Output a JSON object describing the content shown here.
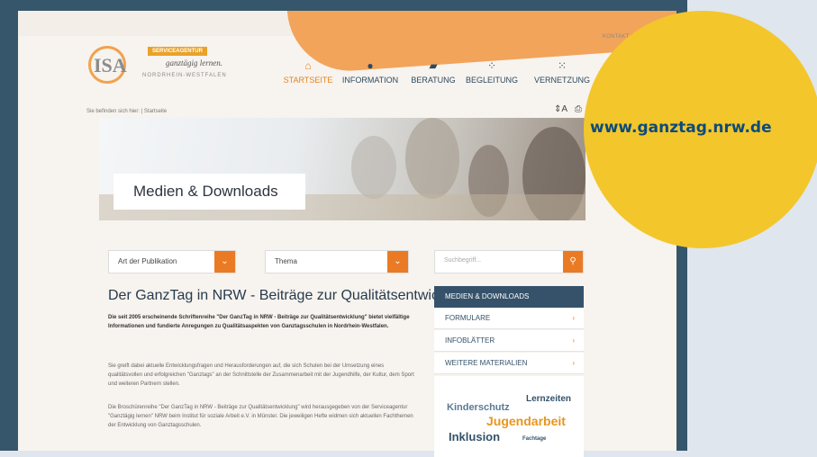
{
  "meta_links": "KONTAKT | IMPRESSUM | DATENSCHUTZ | SITEMAP",
  "logo": {
    "mark": "ISA",
    "badge": "SERVICEAGENTUR",
    "tagline": "ganztägig lernen.",
    "region": "NORDRHEIN-WESTFALEN"
  },
  "nav": [
    {
      "icon": "home-icon",
      "label": "STARTSEITE",
      "active": true
    },
    {
      "icon": "info-icon",
      "label": "INFORMATION",
      "active": false
    },
    {
      "icon": "chat-icon",
      "label": "BERATUNG",
      "active": false
    },
    {
      "icon": "people-icon",
      "label": "BEGLEITUNG",
      "active": false
    },
    {
      "icon": "network-icon",
      "label": "VERNETZUNG",
      "active": false
    }
  ],
  "breadcrumb": "Sie befinden sich hier: | Startseite",
  "hero_title": "Medien & Downloads",
  "filters": {
    "publication": "Art der Publikation",
    "topic": "Thema"
  },
  "search": {
    "placeholder": "Suchbegriff..."
  },
  "article": {
    "title": "Der GanzTag in NRW - Beiträge zur Qualitätsentwicklung",
    "intro": "Die seit 2005 erscheinende Schriftenreihe \"Der GanzTag in NRW - Beiträge zur Qualitätsentwicklung\" bietet vielfältige Informationen und fundierte Anregungen zu Qualitätsaspekten von Ganztagsschulen in Nordrhein-Westfalen.",
    "para1": "Sie greift dabei aktuelle Entwicklungsfragen und Herausforderungen auf, die sich Schulen bei der Umsetzung eines qualitätsvollen und erfolgreichen \"Ganztags\" an der Schnittstelle der Zusammenarbeit mit der Jugendhilfe, der Kultur, dem Sport und weiteren Partnern stellen.",
    "para2": "Die Broschürenreihe \"Der GanzTag in NRW - Beiträge zur Qualitätsentwicklung\" wird herausgegeben von der Serviceagentur \"Ganztägig lernen\" NRW beim Institut für soziale Arbeit e.V. in Münster. Die jeweiligen Hefte widmen sich aktuellen Fachthemen der Entwicklung von Ganztagsschulen."
  },
  "sidebar": {
    "header": "MEDIEN & DOWNLOADS",
    "items": [
      "FORMULARE",
      "INFOBLÄTTER",
      "WEITERE MATERIALIEN"
    ]
  },
  "tags": [
    "Kinderschutz",
    "Lernzeiten",
    "Jugendarbeit",
    "Inklusion",
    "Fachtage"
  ],
  "url": "www.ganztag.nrw.de",
  "colors": {
    "accent": "#ea7b24",
    "navy": "#35526a",
    "yellow": "#f3c62c",
    "frame": "#36566c"
  }
}
